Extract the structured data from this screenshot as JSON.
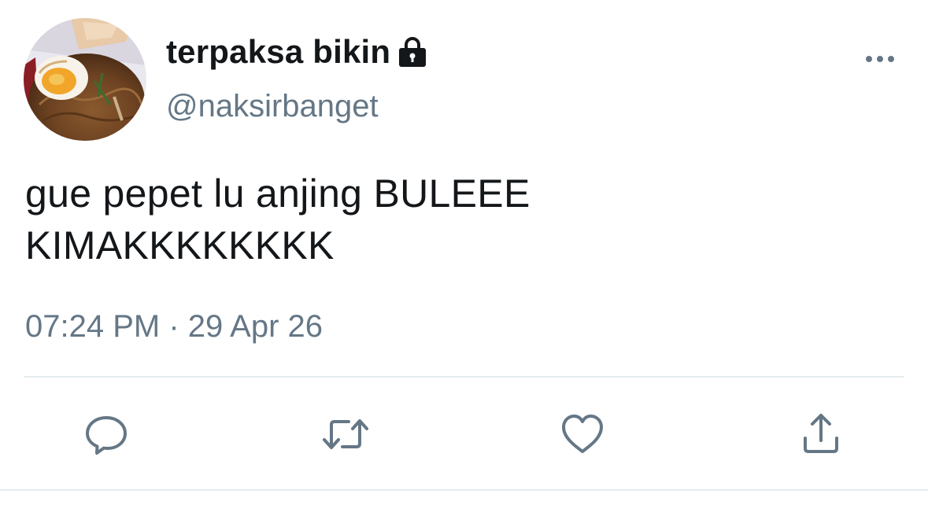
{
  "user": {
    "display_name": "terpaksa bikin",
    "handle": "@naksirbanget",
    "protected_icon": "lock-icon",
    "avatar_icon": "food-photo-avatar"
  },
  "tweet": {
    "text": "gue pepet lu anjing BULEEE\nKIMAKKKKKKKK",
    "timestamp": "07:24 PM · 29 Apr 26"
  },
  "actions": {
    "reply_icon": "speech-bubble-icon",
    "retweet_icon": "retweet-icon",
    "like_icon": "heart-icon",
    "share_icon": "share-upload-icon",
    "more_icon": "more-dots-icon"
  },
  "colors": {
    "primary_text": "#14171a",
    "secondary_text": "#657786",
    "divider": "#e6ecf0"
  }
}
